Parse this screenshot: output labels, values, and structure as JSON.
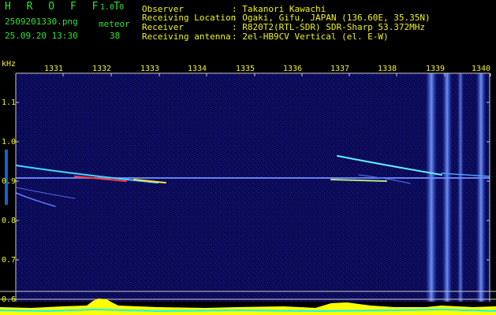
{
  "app": {
    "logo": "H R O F F T",
    "version": "1.0.0",
    "filename": "2509201330.png",
    "datetime": "25.09.20 13:30",
    "meteor_label": "meteor",
    "meteor_count": "38"
  },
  "info": {
    "labels": [
      "Observer",
      "Receiving Location",
      "Receiver",
      "Receiving antenna"
    ],
    "values": [
      ": Takanori Kawachi",
      ": Ogaki, Gifu, JAPAN (136.60E, 35.35N)",
      ": R820T2(RTL-SDR) SDR-Sharp 53.372MHz",
      ": 2el-HB9CV Vertical (el. E-W)"
    ]
  },
  "axis": {
    "unit": "kHz",
    "y_ticks": [
      "1.1",
      "1.0",
      "0.9",
      "0.8",
      "0.7",
      "0.6"
    ],
    "x_ticks": [
      "1331",
      "1332",
      "1333",
      "1334",
      "1335",
      "1336",
      "1337",
      "1338",
      "1339",
      "1340"
    ]
  },
  "colors": {
    "background": "#000000",
    "spectrum_bg": "#0a0a55",
    "text_green": "#2fe32f",
    "text_yellow": "#f2f21a",
    "axis_line": "#c8c8c8",
    "level_fill": "#ffff00",
    "level_line": "#00ffff"
  }
}
